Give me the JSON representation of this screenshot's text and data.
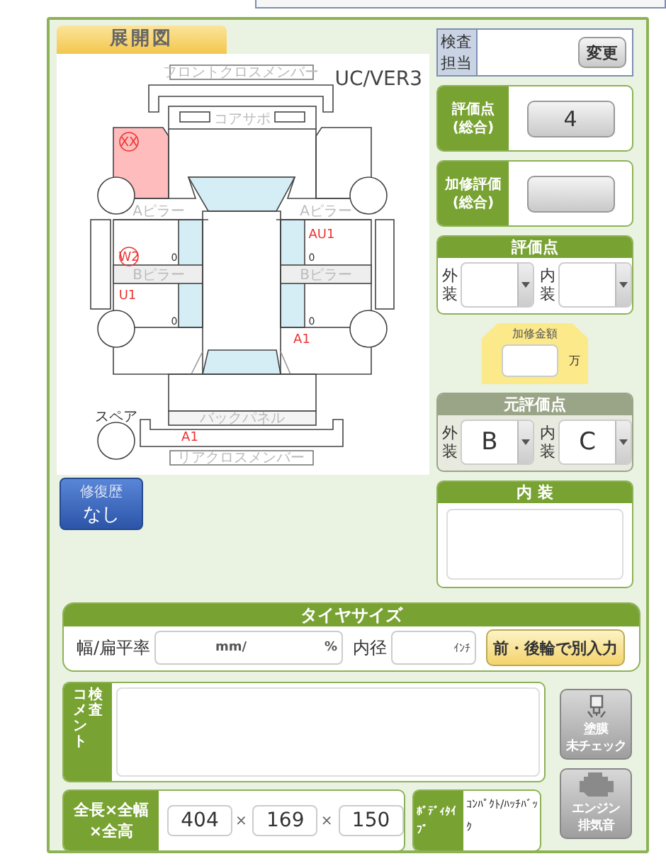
{
  "diagram": {
    "tab": "展開図",
    "version": "UC/VER3",
    "labels": [
      {
        "text": "フロントクロスメンバー"
      },
      {
        "text": "コアサポ"
      },
      {
        "text": "Aピラー"
      },
      {
        "text": "Aピラー"
      },
      {
        "text": "Bピラー"
      },
      {
        "text": "Bピラー"
      },
      {
        "text": "バックパネル"
      },
      {
        "text": "リアクロスメンバー"
      },
      {
        "text": "スペア"
      }
    ],
    "fenders": [
      {
        "highlighted": true
      },
      {
        "highlighted": false
      }
    ],
    "marks": [
      {
        "kind": "damage",
        "text": "XX",
        "circled": true
      },
      {
        "kind": "damage",
        "text": "W2",
        "circled": true
      },
      {
        "kind": "damage",
        "text": "U1",
        "circled": false
      },
      {
        "kind": "damage",
        "text": "AU1",
        "circled": false
      },
      {
        "kind": "damage",
        "text": "A1",
        "circled": false
      },
      {
        "kind": "damage",
        "text": "A1",
        "circled": false
      },
      {
        "kind": "count",
        "text": "0"
      },
      {
        "kind": "count",
        "text": "0"
      },
      {
        "kind": "count",
        "text": "0"
      },
      {
        "kind": "count",
        "text": "0"
      }
    ]
  },
  "repair_history": {
    "label": "修復歴",
    "value": "なし"
  },
  "inspector": {
    "label": "検査担当",
    "button": "変更"
  },
  "overall_score": {
    "label": "評価点\n(総合)",
    "value": "4"
  },
  "repair_score": {
    "label": "加修評価\n(総合)"
  },
  "score": {
    "title": "評価点",
    "exterior": {
      "label": "外装"
    },
    "interior": {
      "label": "内装"
    }
  },
  "repair_cost": {
    "label": "加修金額",
    "unit": "万"
  },
  "original_score": {
    "title": "元評価点",
    "exterior": {
      "label": "外装",
      "value": "B"
    },
    "interior": {
      "label": "内装",
      "value": "C"
    }
  },
  "interior_notes": {
    "title": "内 装"
  },
  "tire_size": {
    "title": "タイヤサイズ",
    "width_label": "幅/扁平率",
    "width_unit": "mm/",
    "ratio_unit": "%",
    "diameter_label": "内径",
    "diameter_unit": "ｲﾝﾁ",
    "button": "前・後輪で別入力"
  },
  "comment": {
    "label_columns": [
      "コメント",
      "検査"
    ]
  },
  "side_buttons": [
    {
      "kind": "paint",
      "lines": [
        "塗膜",
        "未チェック"
      ]
    },
    {
      "kind": "engine",
      "lines": [
        "エンジン",
        "排気音"
      ]
    }
  ],
  "dimensions": {
    "label": "全長×全幅\n×全高",
    "values": [
      "404",
      "169",
      "150"
    ],
    "separators": [
      "×",
      "×"
    ]
  },
  "body_type": {
    "label": "ﾎﾞﾃﾞｨﾀｲﾌﾟ",
    "value": "ｺﾝﾊﾟｸﾄ/ﾊｯﾁﾊﾞｯｸ"
  }
}
